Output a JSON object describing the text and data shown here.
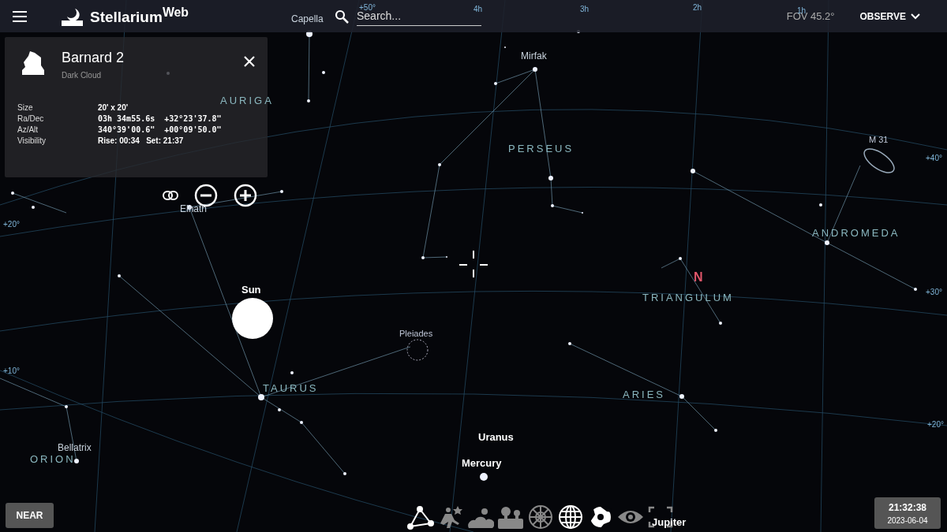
{
  "top_bar": {
    "app_name": "Stellarium$^{Web}$",
    "search": {
      "placeholder": "Search..."
    },
    "fov": "FOV 45.2°",
    "observe_button": "OBSERVE"
  },
  "info_panel": {
    "title": "Barnard 2",
    "subtitle": "Dark Cloud",
    "rows": [
      {
        "label": "Size",
        "value": "20' x 20'"
      },
      {
        "label": "Ra/Dec",
        "value": "03h 34m55.6s  +32°23'37.8\""
      },
      {
        "label": "Az/Alt",
        "value": "340°39'00.6\"  +00°09'50.0\""
      },
      {
        "label": "Visibility",
        "value": "Rise: 00:34   Set: 21:37"
      }
    ]
  },
  "sky_labels": [
    {
      "text": "Capella",
      "kind": "star"
    },
    {
      "text": "Mirfak",
      "kind": "star"
    },
    {
      "text": "AURIGA",
      "kind": "constellation"
    },
    {
      "text": "PERSEUS",
      "kind": "constellation"
    },
    {
      "text": "M 31",
      "kind": "dso"
    },
    {
      "text": "ANDROMEDA",
      "kind": "constellation"
    },
    {
      "text": "TRIANGULUM",
      "kind": "constellation"
    },
    {
      "text": "N",
      "kind": "cardinal"
    },
    {
      "text": "Sun",
      "kind": "planet"
    },
    {
      "text": "Pleiades",
      "kind": "dso"
    },
    {
      "text": "Elnath",
      "kind": "star"
    },
    {
      "text": "TAURUS",
      "kind": "constellation"
    },
    {
      "text": "ARIES",
      "kind": "constellation"
    },
    {
      "text": "Uranus",
      "kind": "planet"
    },
    {
      "text": "Mercury",
      "kind": "planet"
    },
    {
      "text": "Bellatrix",
      "kind": "star"
    },
    {
      "text": "ORION",
      "kind": "constellation"
    },
    {
      "text": "Jupiter",
      "kind": "planet"
    },
    {
      "text": "+50°",
      "kind": "grid"
    },
    {
      "text": "4h",
      "kind": "grid"
    },
    {
      "text": "3h",
      "kind": "grid"
    },
    {
      "text": "2h",
      "kind": "grid"
    },
    {
      "text": "1h",
      "kind": "grid"
    },
    {
      "text": "+40°",
      "kind": "grid"
    },
    {
      "text": "+30°",
      "kind": "grid"
    },
    {
      "text": "+20°",
      "kind": "grid"
    },
    {
      "text": "+10°",
      "kind": "grid"
    },
    {
      "text": "+20°",
      "kind": "grid"
    }
  ],
  "near_button": "NEAR",
  "toolbar": [
    {
      "kind": "constellation-lines",
      "on": true
    },
    {
      "kind": "constellation-art",
      "on": false
    },
    {
      "kind": "atmosphere",
      "on": false
    },
    {
      "kind": "landscape",
      "on": false
    },
    {
      "kind": "azimuthal-grid",
      "on": false
    },
    {
      "kind": "equatorial-grid",
      "on": true
    },
    {
      "kind": "deep-sky",
      "on": true
    },
    {
      "kind": "night-mode",
      "on": false
    },
    {
      "kind": "fullscreen",
      "on": false
    }
  ],
  "clock": {
    "time": "21:32:38",
    "date": "2023-06-04"
  }
}
